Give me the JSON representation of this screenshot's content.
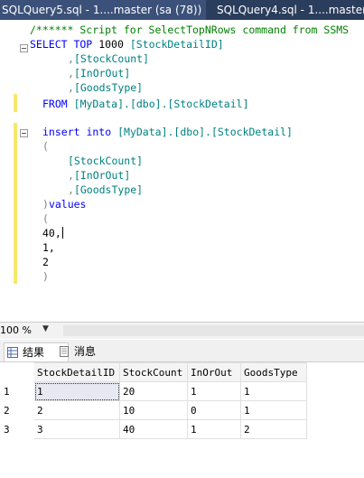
{
  "tabs": [
    {
      "label": "SQLQuery5.sql - 1....master (sa (78))",
      "active": true
    },
    {
      "label": "SQLQuery4.sql - 1....master",
      "active": false
    }
  ],
  "editor": {
    "comment": "/****** Script for SelectTopNRows command from SSMS",
    "select_kw": "SELECT TOP",
    "select_num": "1000",
    "col_stockdetailid": "[StockDetailID]",
    "col_stockcount": "[StockCount]",
    "col_inorout": "[InOrOut]",
    "col_goodstype": "[GoodsType]",
    "from_kw": "FROM",
    "from_table": "[MyData].[dbo].[StockDetail]",
    "insert_kw": "insert into",
    "insert_table": "[MyData].[dbo].[StockDetail]",
    "open_paren": "(",
    "close_paren": ")",
    "values_kw": "values",
    "val1": "40,",
    "val2": "1,",
    "val3": "2",
    "comma": ","
  },
  "statusbar": {
    "zoom": "100 %"
  },
  "results": {
    "tab_results": "结果",
    "tab_messages": "消息",
    "columns": [
      "StockDetailID",
      "StockCount",
      "InOrOut",
      "GoodsType"
    ],
    "rows": [
      {
        "n": "1",
        "cells": [
          "1",
          "20",
          "1",
          "1"
        ]
      },
      {
        "n": "2",
        "cells": [
          "2",
          "10",
          "0",
          "1"
        ]
      },
      {
        "n": "3",
        "cells": [
          "3",
          "40",
          "1",
          "2"
        ]
      }
    ]
  }
}
